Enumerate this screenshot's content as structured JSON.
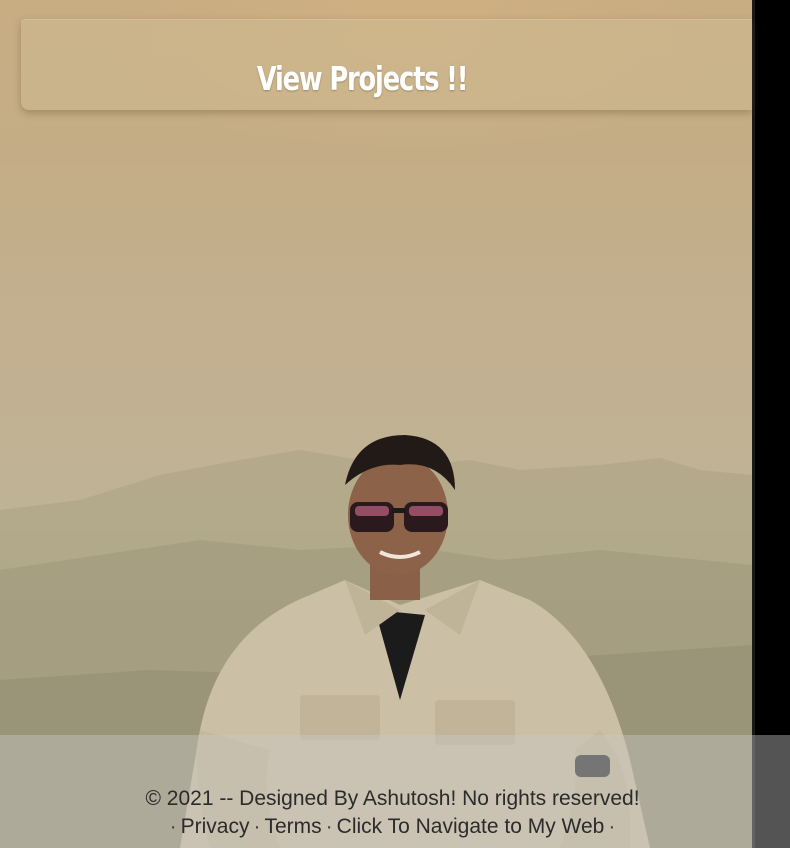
{
  "header": {
    "projects_label": "View Projects !!"
  },
  "footer": {
    "copyright": "© 2021 -- Designed By Ashutosh! No rights reserved!",
    "separator": "·",
    "links": [
      {
        "label": "Privacy"
      },
      {
        "label": "Terms"
      },
      {
        "label": "Click To Navigate to My Web"
      }
    ]
  },
  "colors": {
    "scrollbar": "#000000",
    "title_text": "#ffffff",
    "footer_text": "#2b2b2b"
  }
}
